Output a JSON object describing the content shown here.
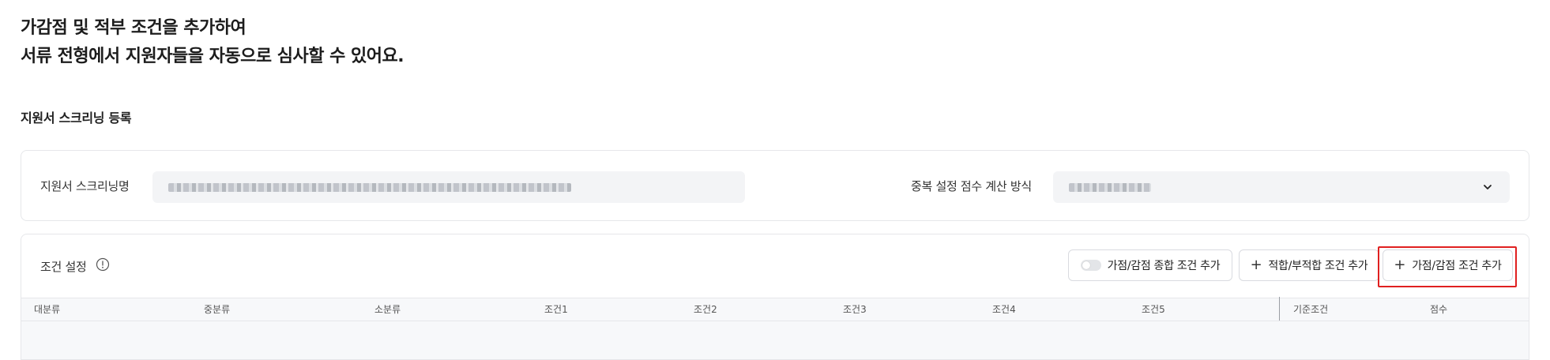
{
  "intro": {
    "line1": "가감점 및 적부 조건을 추가하여",
    "line2": "서류 전형에서 지원자들을 자동으로 심사할 수 있어요."
  },
  "section_title": "지원서 스크리닝 등록",
  "form": {
    "name_label": "지원서 스크리닝명",
    "calc_label": "중복 설정 점수 계산 방식"
  },
  "conditions": {
    "title": "조건 설정",
    "buttons": {
      "total_condition": "가점/감점 종합 조건 추가",
      "fit_condition": "적합/부적합 조건 추가",
      "score_condition": "가점/감점 조건 추가"
    },
    "columns": [
      "대분류",
      "중분류",
      "소분류",
      "조건1",
      "조건2",
      "조건3",
      "조건4",
      "조건5",
      "기준조건",
      "점수"
    ]
  },
  "icons": {
    "info": "info-icon",
    "chevron": "chevron-down-icon",
    "plus": "plus-icon"
  },
  "colors": {
    "highlight": "#e02020",
    "field_bg": "#f3f4f6"
  }
}
